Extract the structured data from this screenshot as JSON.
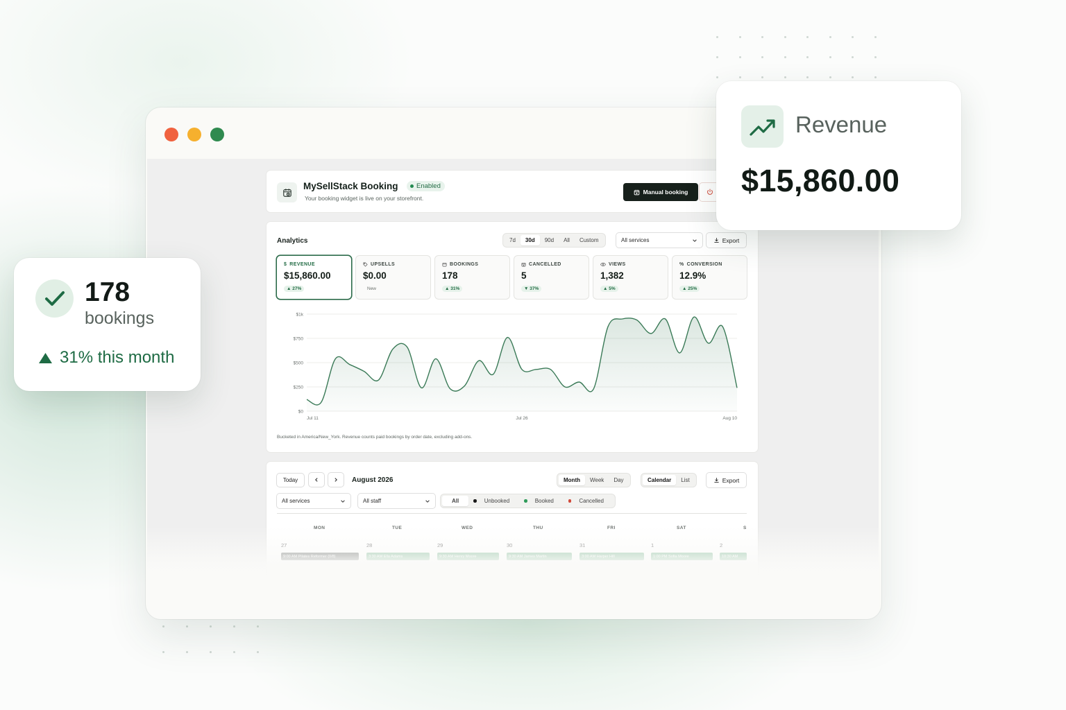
{
  "window": {
    "traffic_lights": [
      "close",
      "minimize",
      "maximize"
    ]
  },
  "header": {
    "title": "MySellStack Booking",
    "status_badge": "Enabled",
    "subtitle": "Your booking widget is live on your storefront.",
    "manual_booking_label": "Manual booking",
    "power_icon": "power-icon"
  },
  "analytics": {
    "title": "Analytics",
    "ranges": [
      "7d",
      "30d",
      "90d",
      "All",
      "Custom"
    ],
    "selected_range": "30d",
    "services_select": "All services",
    "export_label": "Export",
    "kpis": [
      {
        "label": "REVENUE",
        "value": "$15,860.00",
        "change": "▲ 27%",
        "icon": "dollar-icon"
      },
      {
        "label": "UPSELLS",
        "value": "$0.00",
        "change": "New",
        "icon": "tag-icon"
      },
      {
        "label": "BOOKINGS",
        "value": "178",
        "change": "▲ 31%",
        "icon": "calendar-icon"
      },
      {
        "label": "CANCELLED",
        "value": "5",
        "change": "▼ 37%",
        "icon": "calendar-x-icon"
      },
      {
        "label": "VIEWS",
        "value": "1,382",
        "change": "▲ 5%",
        "icon": "eye-icon"
      },
      {
        "label": "CONVERSION",
        "value": "12.9%",
        "change": "▲ 25%",
        "icon": "percent-icon"
      }
    ],
    "footnote": "Bucketed in America/New_York. Revenue counts paid bookings by order date, excluding add-ons."
  },
  "chart_data": {
    "type": "area",
    "title": "",
    "xlabel": "",
    "ylabel": "",
    "x_tick_labels": [
      "Jul 11",
      "Jul 26",
      "Aug 10"
    ],
    "y_tick_labels": [
      "$0",
      "$250",
      "$500",
      "$750",
      "$1k"
    ],
    "ylim": [
      0,
      1000
    ],
    "grid": true,
    "x": [
      "Jul 11",
      "Jul 12",
      "Jul 13",
      "Jul 14",
      "Jul 15",
      "Jul 16",
      "Jul 17",
      "Jul 18",
      "Jul 19",
      "Jul 20",
      "Jul 21",
      "Jul 22",
      "Jul 23",
      "Jul 24",
      "Jul 25",
      "Jul 26",
      "Jul 27",
      "Jul 28",
      "Jul 29",
      "Jul 30",
      "Jul 31",
      "Aug 1",
      "Aug 2",
      "Aug 3",
      "Aug 4",
      "Aug 5",
      "Aug 6",
      "Aug 7",
      "Aug 8",
      "Aug 9",
      "Aug 10"
    ],
    "series": [
      {
        "values": [
          120,
          90,
          540,
          480,
          410,
          320,
          640,
          660,
          240,
          540,
          230,
          260,
          520,
          380,
          760,
          430,
          430,
          430,
          250,
          300,
          230,
          870,
          950,
          940,
          800,
          950,
          600,
          970,
          700,
          870,
          240
        ]
      }
    ],
    "color": "#3a7a57"
  },
  "calendar": {
    "today_label": "Today",
    "month_label": "August 2026",
    "views": [
      "Month",
      "Week",
      "Day"
    ],
    "selected_view": "Month",
    "modes": [
      "Calendar",
      "List"
    ],
    "selected_mode": "Calendar",
    "export_label": "Export",
    "services_select": "All services",
    "staff_select": "All staff",
    "filters": [
      {
        "label": "All",
        "color": ""
      },
      {
        "label": "Unbooked",
        "color": "#1a1a1a"
      },
      {
        "label": "Booked",
        "color": "#2f9b5a"
      },
      {
        "label": "Cancelled",
        "color": "#d14a3a"
      }
    ],
    "weekdays": [
      "MON",
      "TUE",
      "WED",
      "THU",
      "FRI",
      "SAT",
      "S"
    ],
    "dates": [
      "27",
      "28",
      "29",
      "30",
      "31",
      "1",
      "2"
    ],
    "events": [
      {
        "label": "9:00 AM Pilates Reformer (0/8)",
        "color": "#6b6f6d"
      },
      {
        "label": "3:30 AM Ella Adams",
        "color": "#7fb894"
      },
      {
        "label": "9:30 AM Henry Moore",
        "color": "#7fb894"
      },
      {
        "label": "9:30 AM James Martin",
        "color": "#7fb894"
      },
      {
        "label": "3:00 AM Harper Hill",
        "color": "#7fb894"
      },
      {
        "label": "1:00 PM Sofia Moore",
        "color": "#7fb894"
      },
      {
        "label": "10:30 AM",
        "color": "#7fb894"
      }
    ]
  },
  "floating_revenue": {
    "label": "Revenue",
    "value": "$15,860.00",
    "icon": "trending-up-icon"
  },
  "floating_bookings": {
    "count": "178",
    "unit": "bookings",
    "trend": "31% this month",
    "icon": "check-icon"
  }
}
